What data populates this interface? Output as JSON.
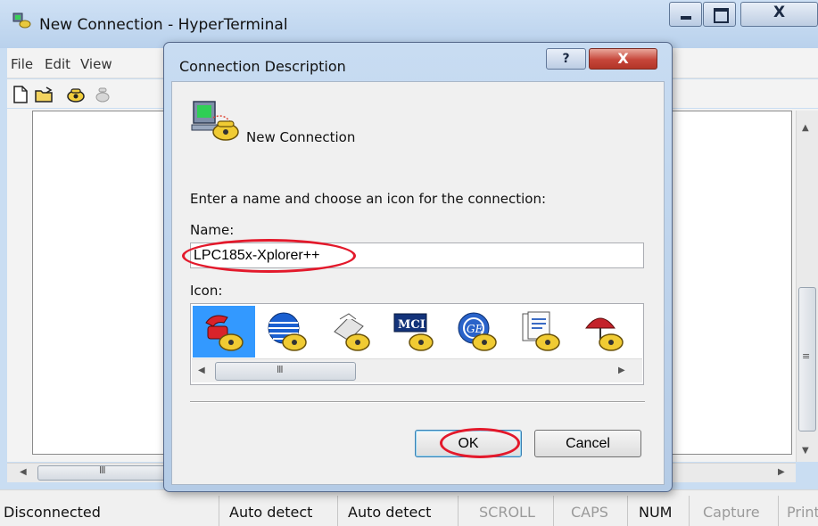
{
  "main_window": {
    "title": "New Connection - HyperTerminal",
    "menu": [
      "File",
      "Edit",
      "View"
    ]
  },
  "toolbar": {
    "icons": [
      "new-document-icon",
      "open-folder-icon",
      "phone-icon",
      "disconnect-icon"
    ]
  },
  "statusbar": {
    "connection": "Disconnected",
    "detect_1": "Auto detect",
    "detect_2": "Auto detect",
    "scroll": "SCROLL",
    "caps": "CAPS",
    "num": "NUM",
    "capture": "Capture",
    "print": "Print echo"
  },
  "dialog": {
    "title": "Connection Description",
    "help": "?",
    "close": "X",
    "connection_name": "New Connection",
    "instruction": "Enter a name and choose an icon for the connection:",
    "name_label": "Name:",
    "name_value": "LPC185x-Xplorer++",
    "icon_label": "Icon:",
    "icons": [
      "red-phone-icon",
      "globe-phone-icon",
      "fax-phone-icon",
      "mci-phone-icon",
      "ge-phone-icon",
      "document-phone-icon",
      "umbrella-phone-icon"
    ],
    "selected_icon": 0,
    "ok_label": "OK",
    "cancel_label": "Cancel"
  },
  "colors": {
    "highlight_annotation": "#e3192b",
    "selection": "#3399ff",
    "title_bar": "#c9ddf2"
  }
}
